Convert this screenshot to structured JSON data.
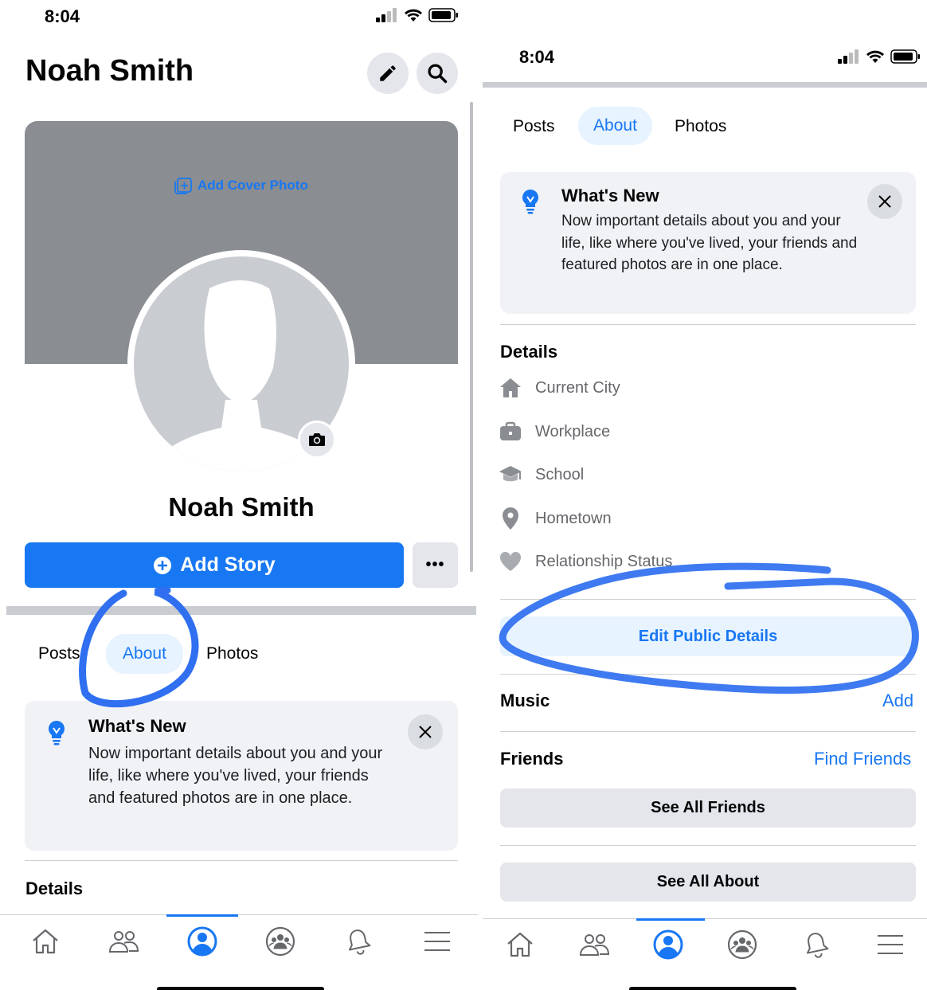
{
  "left": {
    "status": {
      "time": "8:04"
    },
    "header": {
      "title": "Noah Smith"
    },
    "cover": {
      "add_label": "Add Cover Photo"
    },
    "profile": {
      "name": "Noah Smith"
    },
    "actions": {
      "add_story": "Add Story",
      "more": "•••"
    },
    "tabs": [
      {
        "label": "Posts"
      },
      {
        "label": "About",
        "active": true
      },
      {
        "label": "Photos"
      }
    ],
    "whats_new": {
      "title": "What's New",
      "body": "Now important details about you and your life, like where you've lived, your friends and featured photos are in one place."
    },
    "details_title": "Details"
  },
  "right": {
    "status": {
      "time": "8:04"
    },
    "tabs": [
      {
        "label": "Posts"
      },
      {
        "label": "About",
        "active": true
      },
      {
        "label": "Photos"
      }
    ],
    "whats_new": {
      "title": "What's New",
      "body": "Now important details about you and your life, like where you've lived, your friends and featured photos are in one place."
    },
    "details": {
      "title": "Details",
      "items": [
        {
          "label": "Current City",
          "icon": "house-icon"
        },
        {
          "label": "Workplace",
          "icon": "briefcase-icon"
        },
        {
          "label": "School",
          "icon": "graduation-cap-icon"
        },
        {
          "label": "Hometown",
          "icon": "location-pin-icon"
        },
        {
          "label": "Relationship Status",
          "icon": "heart-icon"
        }
      ]
    },
    "edit_public_details": "Edit Public Details",
    "music": {
      "title": "Music",
      "action": "Add"
    },
    "friends": {
      "title": "Friends",
      "action": "Find Friends",
      "see_all": "See All Friends"
    },
    "see_all_about": "See All About"
  },
  "bottom_nav": [
    {
      "icon": "home-icon"
    },
    {
      "icon": "friends-icon"
    },
    {
      "icon": "profile-icon",
      "active": true
    },
    {
      "icon": "groups-icon"
    },
    {
      "icon": "bell-icon"
    },
    {
      "icon": "menu-icon"
    }
  ],
  "colors": {
    "brand": "#1877f2",
    "annotation": "#2f6ff0"
  }
}
